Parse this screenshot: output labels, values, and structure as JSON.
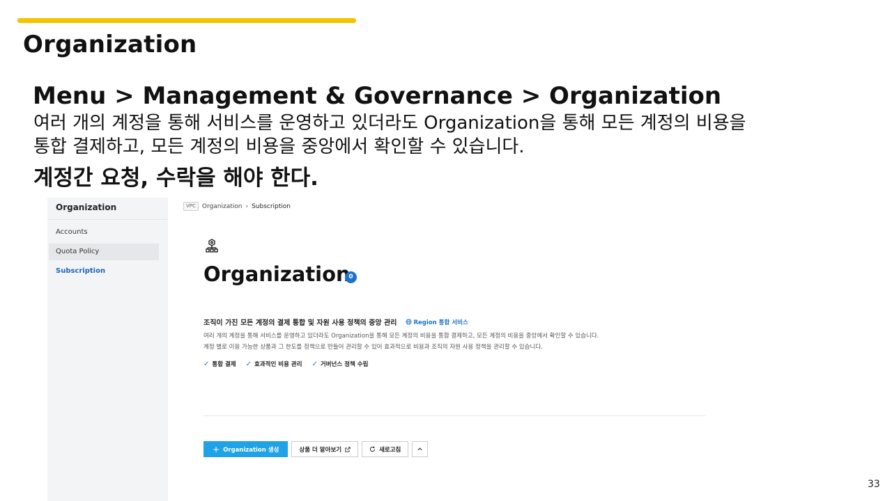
{
  "slide": {
    "title": "Organization",
    "breadcrumb_heading": "Menu > Management & Governance > Organization",
    "description_line1": "여러 개의 계정을 통해 서비스를 운영하고 있더라도 Organization을 통해 모든 계정의 비용을",
    "description_line2": "통합 결제하고, 모든 계정의 비용을 중앙에서 확인할 수 있습니다.",
    "emphasis": "계정간 요청, 수락을 해야 한다.",
    "page_number": "33",
    "accent_color": "#f5c400"
  },
  "console": {
    "sidebar": {
      "title": "Organization",
      "items": [
        {
          "label": "Accounts",
          "state": "normal"
        },
        {
          "label": "Quota Policy",
          "state": "hover"
        },
        {
          "label": "Subscription",
          "state": "active"
        }
      ]
    },
    "breadcrumb": {
      "badge": "VPC",
      "items": [
        "Organization",
        "Subscription"
      ]
    },
    "header": {
      "icon": "organization-icon",
      "title": "Organization",
      "count": "0"
    },
    "section": {
      "heading": "조직이 가진 모든 계정의 결제 통합 및 자원 사용 정책의 중앙 관리",
      "region_tag": "Region 통합 서비스",
      "desc_line1": "여러 개의 계정을 통해 서비스를 운영하고 있더라도 Organization을 통해 모든 계정의 비용을 통합 결제하고, 모든 계정의 비용을 중앙에서 확인할 수 있습니다.",
      "desc_line2": "계정 별로 이용 가능한 상품과 그 한도를 정책으로 만들어 관리할 수 있어 효과적으로 비용과 조직의 자원 사용 정책을 관리할 수 있습니다.",
      "features": [
        "통합 결제",
        "효과적인 비용 관리",
        "거버넌스 정책 수립"
      ]
    },
    "actions": {
      "create": "Organization 생성",
      "learn_more": "상품 더 알아보기",
      "refresh": "새로고침"
    },
    "colors": {
      "primary_button": "#1fa2e6",
      "link_blue": "#1d73c9",
      "active_nav": "#1d63b8",
      "sidebar_bg": "#f3f4f6"
    }
  }
}
